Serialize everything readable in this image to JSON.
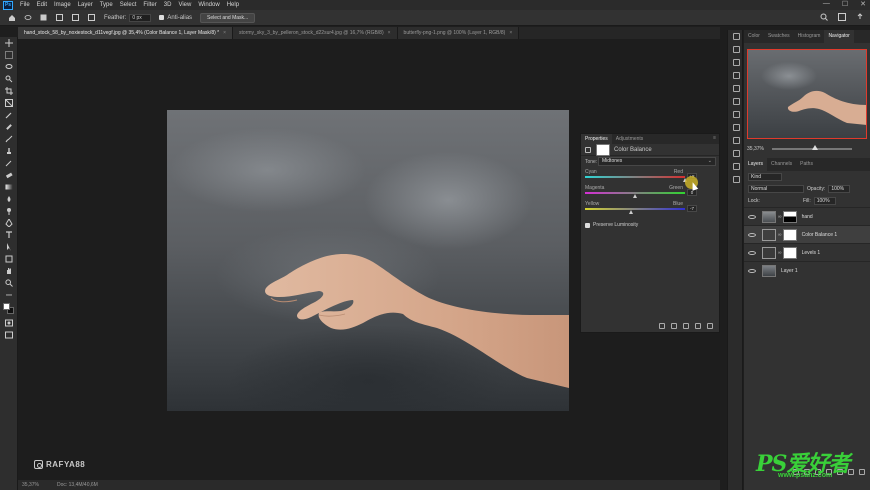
{
  "menubar": {
    "logo": "Ps",
    "items": [
      "File",
      "Edit",
      "Image",
      "Layer",
      "Type",
      "Select",
      "Filter",
      "3D",
      "View",
      "Window",
      "Help"
    ],
    "window_controls": [
      "—",
      "☐",
      "✕"
    ]
  },
  "optionsbar": {
    "feather_label": "Feather:",
    "feather_value": "0 px",
    "antialias_label": "Anti-alias",
    "select_mask_button": "Select and Mask..."
  },
  "tabs": [
    {
      "label": "hand_stock_58_by_noxiestock_d11vegf.jpg @ 35,4% (Color Balance 1, Layer Mask/8) *",
      "active": true
    },
    {
      "label": "stormy_sky_3_by_pelleron_stock_d22sur4.jpg @ 16,7% (RGB/8)",
      "active": false
    },
    {
      "label": "butterfly-png-1.png @ 100% (Layer 1, RGB/8)",
      "active": false
    }
  ],
  "watermark": "RAFYA88",
  "statusbar": {
    "zoom": "35,37%",
    "doc": "Doc: 13,4M/40,6M"
  },
  "properties": {
    "tabs": [
      "Properties",
      "Adjustments"
    ],
    "title": "Color Balance",
    "tone_label": "Tone:",
    "tone_value": "Midtones",
    "sliders": [
      {
        "left": "Cyan",
        "right": "Red",
        "value": "+8",
        "fraction": 1.0
      },
      {
        "left": "Magenta",
        "right": "Green",
        "value": "0",
        "fraction": 0.5
      },
      {
        "left": "Yellow",
        "right": "Blue",
        "value": "-7",
        "fraction": 0.46
      }
    ],
    "preserve_label": "Preserve Luminosity"
  },
  "rightpanel": {
    "tabs": [
      "Color",
      "Swatches",
      "Histogram",
      "Navigator"
    ],
    "zoom_value": "35,37%",
    "layers_tabs": [
      "Layers",
      "Channels",
      "Paths"
    ],
    "kind_label": "Kind",
    "blend_mode": "Normal",
    "opacity_label": "Opacity:",
    "opacity_value": "100%",
    "lock_label": "Lock:",
    "fill_label": "Fill:",
    "fill_value": "100%",
    "layers": [
      {
        "name": "hand",
        "selected": false
      },
      {
        "name": "Color Balance 1",
        "selected": true
      },
      {
        "name": "Levels 1",
        "selected": false
      },
      {
        "name": "Layer 1",
        "selected": false
      }
    ]
  },
  "brand": {
    "badge": "PS爱好者",
    "url": "www.psahz.com"
  },
  "colors": {
    "accent": "#31a8ff",
    "highlight": "#c8af28",
    "navigator_frame": "#e03a2c",
    "brand_green": "#39d039"
  }
}
